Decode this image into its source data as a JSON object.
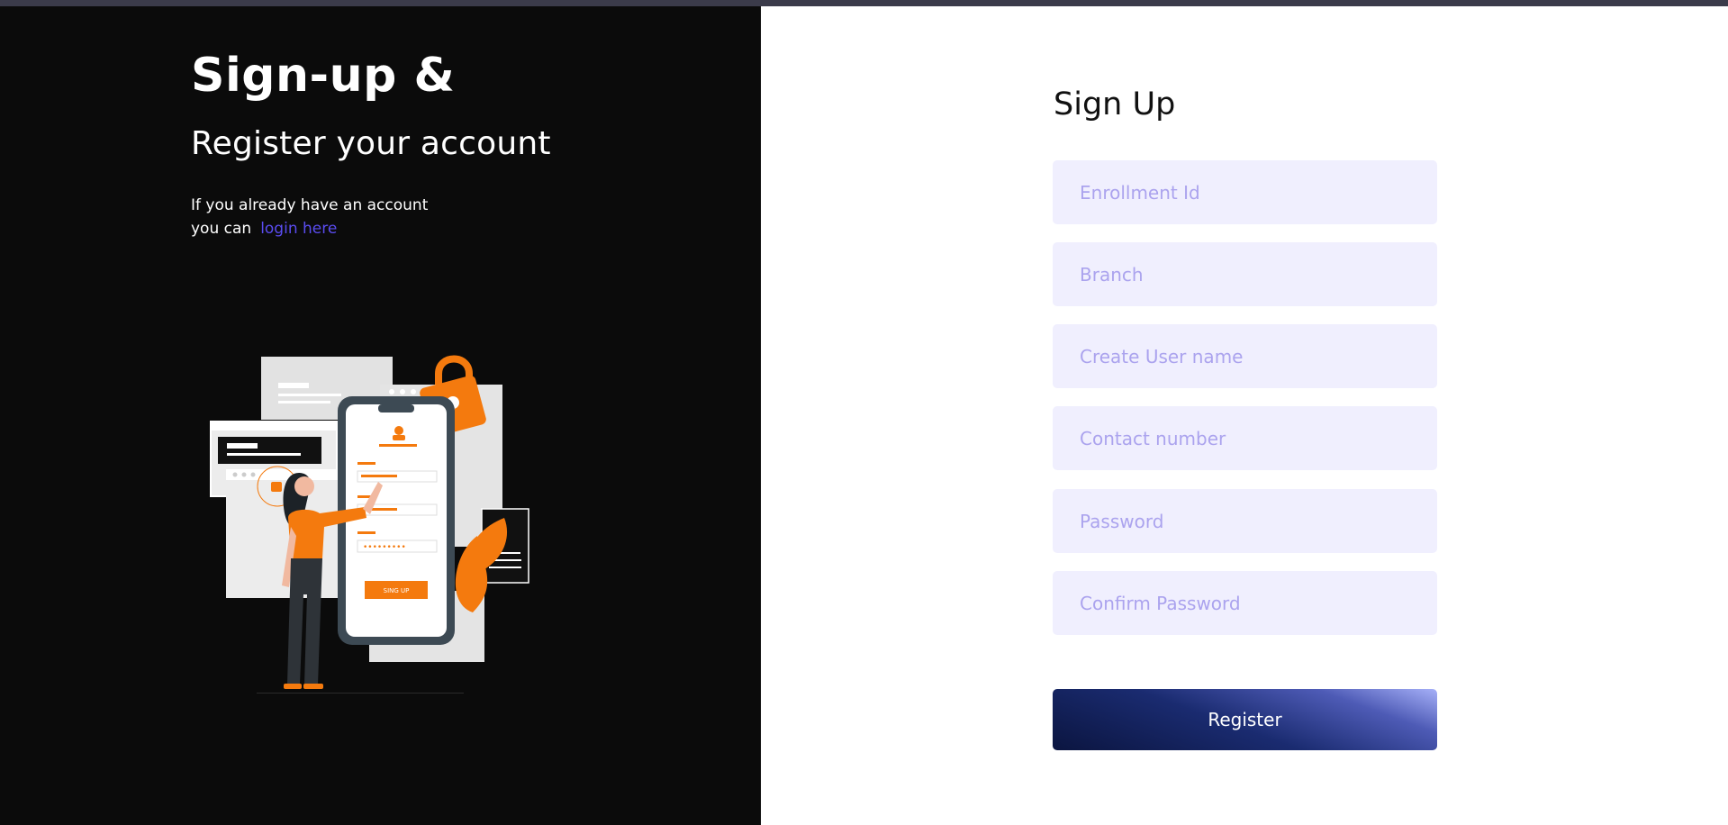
{
  "hero": {
    "title": "Sign-up &",
    "subtitle": "Register your account",
    "note_line1": "If you already have an account",
    "note_line2_prefix": "you can",
    "login_link": "login here"
  },
  "illustration": {
    "button_label": "SING UP",
    "password_mask": "•••••••••"
  },
  "form": {
    "title": "Sign Up",
    "enrollment_placeholder": "Enrollment Id",
    "branch_placeholder": "Branch",
    "username_placeholder": "Create User name",
    "contact_placeholder": "Contact number",
    "password_placeholder": "Password",
    "confirm_password_placeholder": "Confirm Password",
    "register_label": "Register"
  },
  "colors": {
    "left_bg": "#0b0b0b",
    "accent_orange": "#f47a0e",
    "link": "#5a4cf0",
    "input_bg": "#f0effe",
    "placeholder": "#aba3ee",
    "button_dark": "#0b1540"
  }
}
